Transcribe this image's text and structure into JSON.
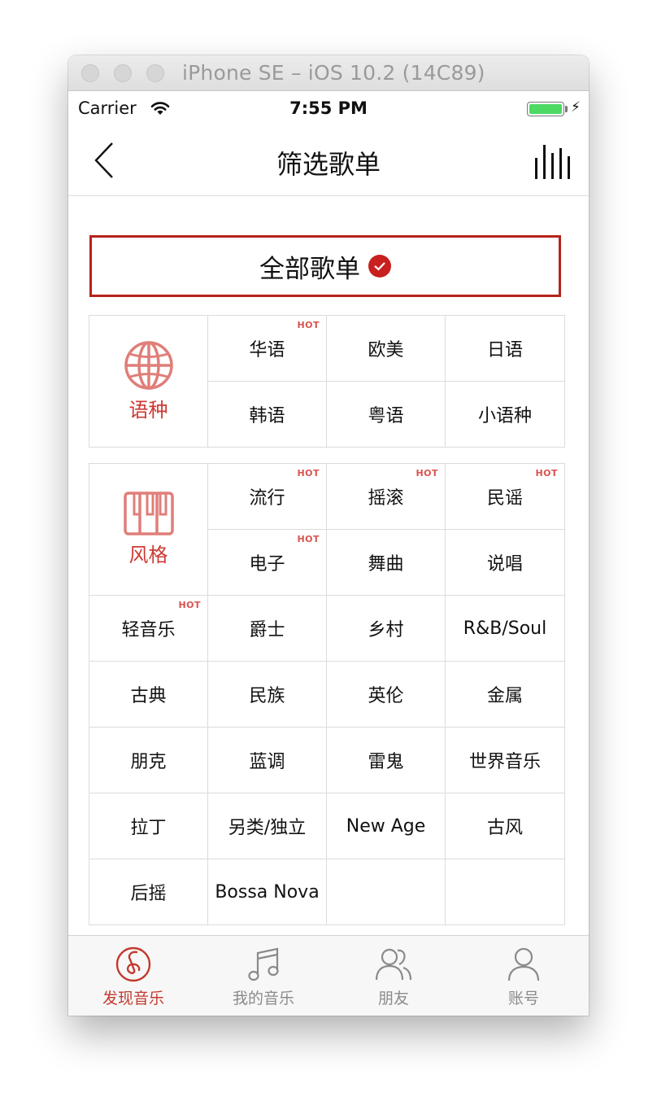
{
  "window": {
    "title": "iPhone SE – iOS 10.2 (14C89)"
  },
  "status": {
    "carrier": "Carrier",
    "time": "7:55 PM"
  },
  "nav": {
    "title": "筛选歌单"
  },
  "all": {
    "label": "全部歌单"
  },
  "language": {
    "label": "语种",
    "items": [
      {
        "label": "华语",
        "hot": "HOT"
      },
      {
        "label": "欧美",
        "hot": ""
      },
      {
        "label": "日语",
        "hot": ""
      },
      {
        "label": "韩语",
        "hot": ""
      },
      {
        "label": "粤语",
        "hot": ""
      },
      {
        "label": "小语种",
        "hot": ""
      }
    ]
  },
  "style": {
    "label": "风格",
    "items": [
      {
        "label": "流行",
        "hot": "HOT"
      },
      {
        "label": "摇滚",
        "hot": "HOT"
      },
      {
        "label": "民谣",
        "hot": "HOT"
      },
      {
        "label": "电子",
        "hot": "HOT"
      },
      {
        "label": "舞曲",
        "hot": ""
      },
      {
        "label": "说唱",
        "hot": ""
      },
      {
        "label": "轻音乐",
        "hot": "HOT"
      },
      {
        "label": "爵士",
        "hot": ""
      },
      {
        "label": "乡村",
        "hot": ""
      },
      {
        "label": "R&B/Soul",
        "hot": ""
      },
      {
        "label": "古典",
        "hot": ""
      },
      {
        "label": "民族",
        "hot": ""
      },
      {
        "label": "英伦",
        "hot": ""
      },
      {
        "label": "金属",
        "hot": ""
      },
      {
        "label": "朋克",
        "hot": ""
      },
      {
        "label": "蓝调",
        "hot": ""
      },
      {
        "label": "雷鬼",
        "hot": ""
      },
      {
        "label": "世界音乐",
        "hot": ""
      },
      {
        "label": "拉丁",
        "hot": ""
      },
      {
        "label": "另类/独立",
        "hot": ""
      },
      {
        "label": "New Age",
        "hot": ""
      },
      {
        "label": "古风",
        "hot": ""
      },
      {
        "label": "后摇",
        "hot": ""
      },
      {
        "label": "Bossa Nova",
        "hot": ""
      }
    ]
  },
  "tabs": [
    {
      "label": "发现音乐",
      "icon": "netease-music-icon",
      "active": true
    },
    {
      "label": "我的音乐",
      "icon": "music-note-icon",
      "active": false
    },
    {
      "label": "朋友",
      "icon": "friends-icon",
      "active": false
    },
    {
      "label": "账号",
      "icon": "account-icon",
      "active": false
    }
  ],
  "colors": {
    "accent": "#c8201f",
    "category": "#cd3a33",
    "tab_inactive": "#8a8a8a"
  }
}
